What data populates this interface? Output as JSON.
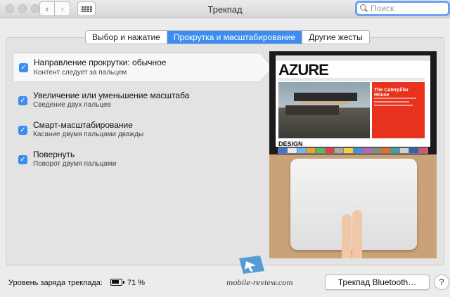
{
  "window": {
    "title": "Трекпад"
  },
  "search": {
    "placeholder": "Поиск"
  },
  "tabs": [
    {
      "label": "Выбор и нажатие",
      "active": false
    },
    {
      "label": "Прокрутка и масштабирование",
      "active": true
    },
    {
      "label": "Другие жесты",
      "active": false
    }
  ],
  "options": [
    {
      "title": "Направление прокрутки: обычное",
      "subtitle": "Контент следует за пальцем",
      "checked": true,
      "selected": true
    },
    {
      "title": "Увеличение или уменьшение масштаба",
      "subtitle": "Сведение двух пальцев",
      "checked": true,
      "selected": false
    },
    {
      "title": "Смарт-масштабирование",
      "subtitle": "Касание двумя пальцами дважды",
      "checked": true,
      "selected": false
    },
    {
      "title": "Повернуть",
      "subtitle": "Поворот двумя пальцами",
      "checked": true,
      "selected": false
    }
  ],
  "preview": {
    "site_logo": "AZURE",
    "article_title": "The Caterpillar House",
    "section_text": "DESIGN"
  },
  "battery": {
    "label": "Уровень заряда трекпада:",
    "percent": "71 %"
  },
  "watermark": {
    "text": "mobile-review.com"
  },
  "buttons": {
    "bluetooth": "Трекпад Bluetooth…",
    "help": "?"
  },
  "colors": {
    "accent": "#3d8cf0",
    "red_card": "#e8321e"
  }
}
